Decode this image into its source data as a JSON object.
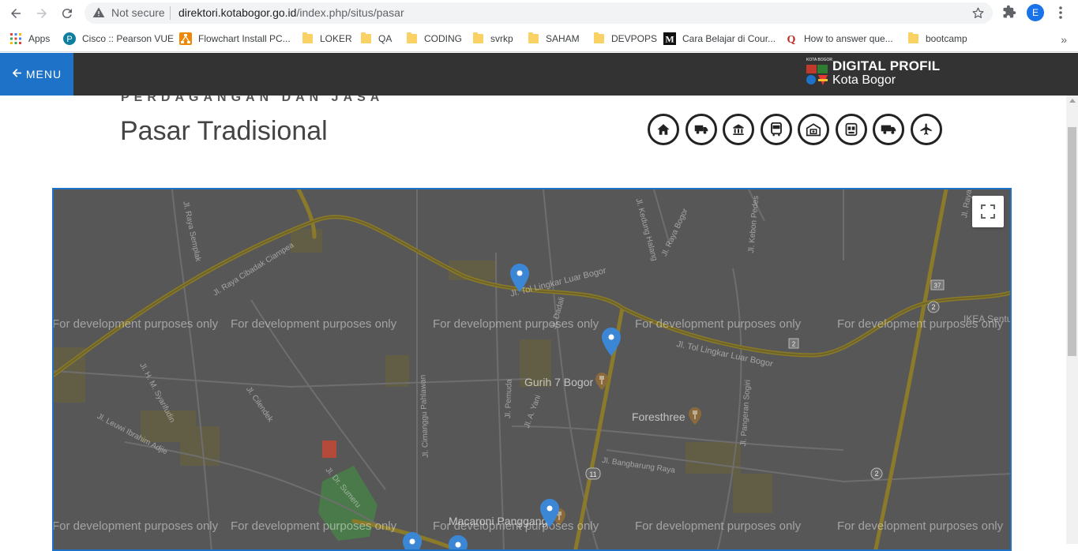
{
  "browser": {
    "security_label": "Not secure",
    "url_host": "direktori.kotabogor.go.id",
    "url_path": "/index.php/situs/pasar",
    "profile_initial": "E",
    "bookmarks": [
      {
        "label": "Apps",
        "icon": "apps-grid-icon"
      },
      {
        "label": "Cisco :: Pearson VUE",
        "icon": "pearson-icon"
      },
      {
        "label": "Flowchart Install PC...",
        "icon": "drawio-icon"
      },
      {
        "label": "LOKER",
        "icon": "folder-icon"
      },
      {
        "label": "QA",
        "icon": "folder-icon"
      },
      {
        "label": "CODING",
        "icon": "folder-icon"
      },
      {
        "label": "svrkp",
        "icon": "folder-icon"
      },
      {
        "label": "SAHAM",
        "icon": "folder-icon"
      },
      {
        "label": "DEVPOPS",
        "icon": "folder-icon"
      },
      {
        "label": "Cara Belajar di Cour...",
        "icon": "medium-icon"
      },
      {
        "label": "How to answer que...",
        "icon": "quora-icon"
      },
      {
        "label": "bootcamp",
        "icon": "folder-icon"
      }
    ],
    "more_label": "»"
  },
  "header": {
    "menu_label": "MENU",
    "logo_line1": "DIGITAL PROFIL",
    "logo_line2": "Kota Bogor",
    "logo_small_text": "KOTA BOGOR"
  },
  "page": {
    "kicker": "PERDAGANGAN DAN JASA",
    "title": "Pasar Tradisional",
    "category_icons": [
      "home-icon",
      "truck-icon",
      "bank-icon",
      "bus-icon",
      "hospital-icon",
      "store-icon",
      "delivery-truck-icon",
      "airplane-icon"
    ]
  },
  "map": {
    "watermark": "For development purposes only",
    "pois": [
      "Gurih 7 Bogor",
      "Foresthree",
      "Macaroni Panggang"
    ],
    "roads": [
      "Jl. Tol Lingkar Luar Bogor",
      "Jl. Raya Cibadak Ciampea",
      "Jl. Raya Semplak",
      "Jl. Dadali",
      "Jl. Pemuda",
      "Jl. A. Yani",
      "Jl. Cimanggu Pahlawan",
      "Jl. Bangbarung Raya",
      "Jl. Pangeran Sogiri",
      "Jl. Dr. Sumeru",
      "Jl. Cilendek",
      "Jl. H. M. Syarifudin",
      "Jl. Leuwi Ibrahim Adjie",
      "Jl. Kedung Halang",
      "Jl. Raya Bogor",
      "Jl. Kebon Pedes",
      "Jl. Raya Pajajaran",
      "IKEA Sentul"
    ],
    "shields": [
      "11",
      "2",
      "2",
      "37",
      "2"
    ],
    "colors": {
      "map_bg": "#575757",
      "road": "#8a7a2a",
      "pin": "#3b87d6",
      "accent": "#1e73c8"
    }
  }
}
